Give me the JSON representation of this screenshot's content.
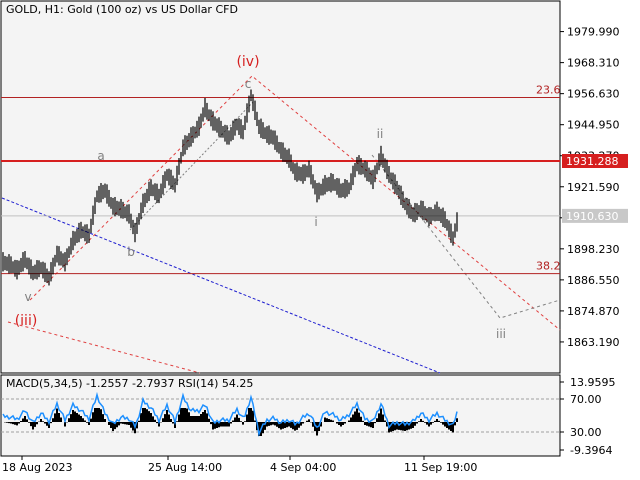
{
  "header": {
    "title": "GOLD, H1:  Gold (100 oz) vs US Dollar CFD"
  },
  "indicator_header": {
    "text": "MACD(5,34,5) -1.2557 -2.7937 RSI(14) 54.25"
  },
  "colors": {
    "bg": "#f4f4f4",
    "candle": "#000000",
    "red_level": "#d61f1f",
    "fib_line": "#b22222",
    "channel_red": "#e04040",
    "trend_blue": "#1f1fd0",
    "label_gray": "#808080",
    "label_red": "#d61f1f",
    "rsi_blue": "#1e90ff",
    "macd_hist": "#000000",
    "macd_signal": "#d61f1f"
  },
  "chart_data": [
    {
      "type": "candlestick",
      "title": "GOLD, H1:  Gold (100 oz) vs US Dollar CFD",
      "ylim": [
        1851.5,
        1991.5
      ],
      "y_ticks": [
        "1979.990",
        "1968.310",
        "1956.630",
        "1944.950",
        "1933.270",
        "1921.590",
        "1909.910",
        "1898.230",
        "1886.550",
        "1874.870",
        "1863.190"
      ],
      "x_ticks": [
        "18 Aug 2023",
        "25 Aug 14:00",
        "4 Sep 04:00",
        "11 Sep 19:00"
      ],
      "price_path": [
        [
          0,
          1893
        ],
        [
          8,
          1892
        ],
        [
          14,
          1890
        ],
        [
          22,
          1894
        ],
        [
          30,
          1889
        ],
        [
          38,
          1891
        ],
        [
          46,
          1887
        ],
        [
          54,
          1896
        ],
        [
          62,
          1893
        ],
        [
          70,
          1901
        ],
        [
          78,
          1905
        ],
        [
          86,
          1903
        ],
        [
          94,
          1918
        ],
        [
          102,
          1920
        ],
        [
          110,
          1914
        ],
        [
          118,
          1913
        ],
        [
          126,
          1911
        ],
        [
          132,
          1904
        ],
        [
          140,
          1915
        ],
        [
          148,
          1921
        ],
        [
          156,
          1918
        ],
        [
          164,
          1926
        ],
        [
          172,
          1922
        ],
        [
          180,
          1936
        ],
        [
          188,
          1940
        ],
        [
          196,
          1944
        ],
        [
          202,
          1951
        ],
        [
          210,
          1946
        ],
        [
          218,
          1943
        ],
        [
          226,
          1940
        ],
        [
          234,
          1945
        ],
        [
          240,
          1942
        ],
        [
          248,
          1956
        ],
        [
          256,
          1944
        ],
        [
          264,
          1941
        ],
        [
          270,
          1940
        ],
        [
          278,
          1935
        ],
        [
          286,
          1932
        ],
        [
          292,
          1927
        ],
        [
          300,
          1926
        ],
        [
          306,
          1928
        ],
        [
          314,
          1919
        ],
        [
          322,
          1922
        ],
        [
          330,
          1923
        ],
        [
          338,
          1920
        ],
        [
          346,
          1921
        ],
        [
          354,
          1930
        ],
        [
          362,
          1928
        ],
        [
          370,
          1924
        ],
        [
          378,
          1933
        ],
        [
          386,
          1926
        ],
        [
          394,
          1921
        ],
        [
          402,
          1915
        ],
        [
          410,
          1911
        ],
        [
          418,
          1913
        ],
        [
          426,
          1910
        ],
        [
          434,
          1912
        ],
        [
          442,
          1909
        ],
        [
          450,
          1902
        ],
        [
          456,
          1911
        ]
      ],
      "levels": [
        {
          "name": "23.6",
          "value": 1955.2
        },
        {
          "name": "1931.288",
          "value": 1931.288
        },
        {
          "name": "1910.630",
          "value": 1910.63
        },
        {
          "name": "38.2",
          "value": 1888.9
        }
      ],
      "wave_labels": [
        {
          "text": "(iv)",
          "role": "major"
        },
        {
          "text": "c",
          "role": "minor"
        },
        {
          "text": "a",
          "role": "minor"
        },
        {
          "text": "b",
          "role": "minor"
        },
        {
          "text": "ii",
          "role": "minor"
        },
        {
          "text": "i",
          "role": "minor"
        },
        {
          "text": "iii",
          "role": "minor"
        },
        {
          "text": "v",
          "role": "minor"
        },
        {
          "text": "(iii)",
          "role": "major"
        }
      ]
    },
    {
      "type": "indicator",
      "series": [
        {
          "name": "MACD(5,34,5)",
          "values": [
            -1.2557,
            -2.7937
          ]
        },
        {
          "name": "RSI(14)",
          "values": [
            54.25
          ]
        }
      ],
      "y_ticks": [
        "13.9595",
        "70.00",
        "30.00",
        "-9.3964"
      ]
    }
  ]
}
